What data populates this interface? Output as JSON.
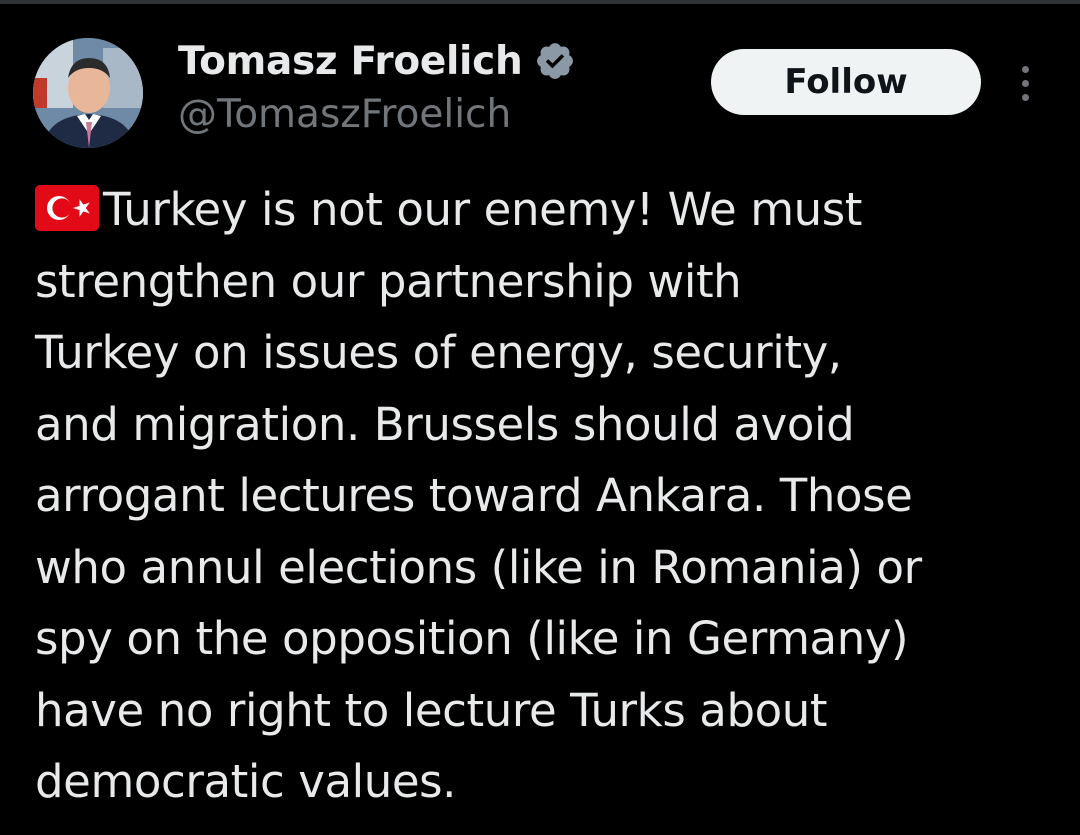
{
  "author": {
    "display_name": "Tomasz Froelich",
    "handle": "@TomaszFroelich",
    "verified": true
  },
  "actions": {
    "follow_label": "Follow"
  },
  "tweet": {
    "flag_icon": "turkey-flag-emoji",
    "lines": [
      "Turkey is not our enemy! We must",
      "strengthen our partnership with",
      "Turkey on issues of energy, security,",
      "and migration. Brussels should avoid",
      "arrogant lectures toward Ankara. Those",
      "who annul elections (like in Romania) or",
      "spy on the opposition (like in Germany)",
      "have no right to lecture Turks about",
      "democratic values."
    ]
  },
  "colors": {
    "background": "#000000",
    "text_primary": "#e7e9ea",
    "text_secondary": "#71767b",
    "verified_badge": "#8b98a5",
    "follow_bg": "#eff3f4",
    "follow_text": "#0f1419",
    "flag_red": "#e30a17"
  }
}
